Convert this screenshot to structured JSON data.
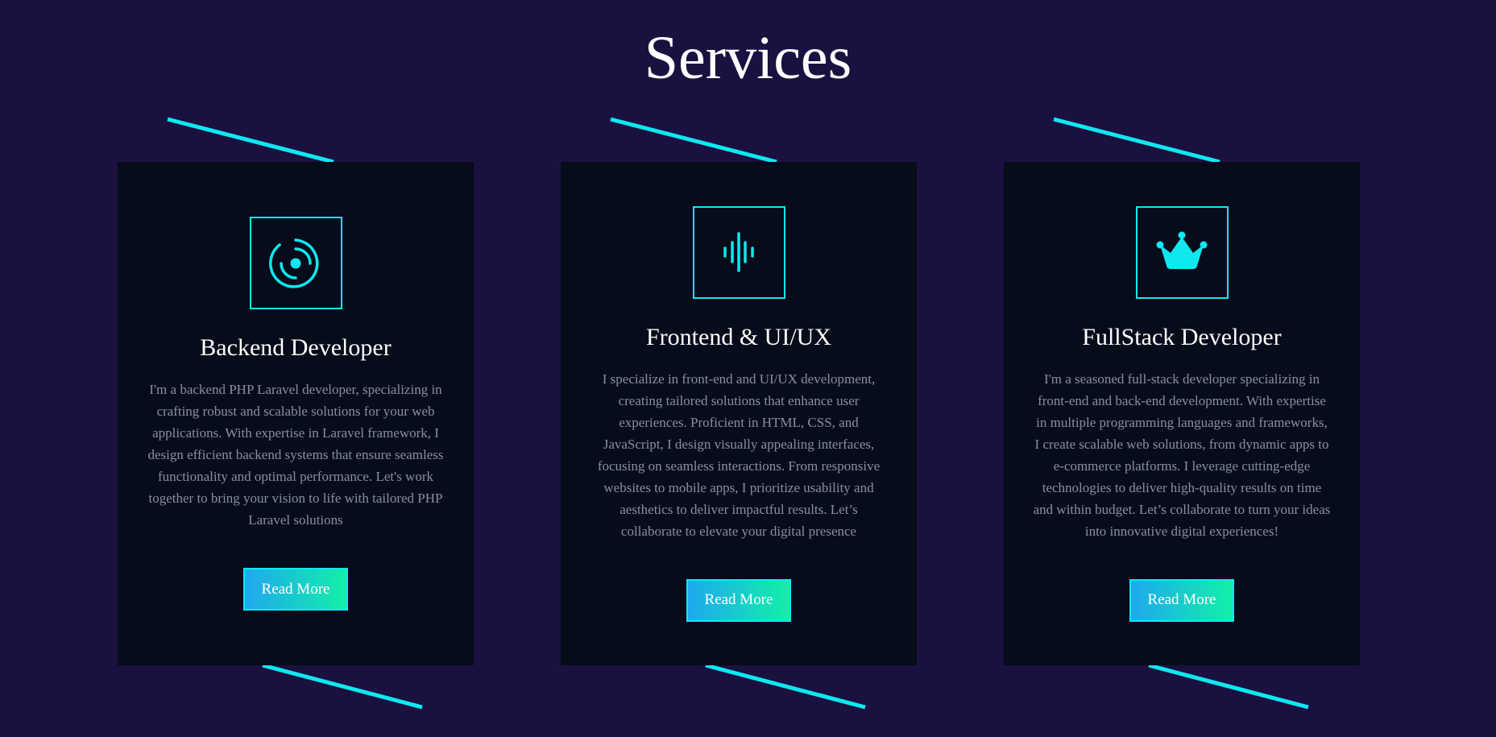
{
  "page": {
    "title": "Services",
    "background_color": "#1a1140",
    "card_color": "#060c1a",
    "accent_color": "#0fe8f0"
  },
  "cards": [
    {
      "icon": "target-icon",
      "title": "Backend Developer",
      "description": "I'm a backend PHP Laravel developer, specializing in crafting robust and scalable solutions for your web applications. With expertise in Laravel framework, I design efficient backend systems that ensure seamless functionality and optimal performance. Let's work together to bring your vision to life with tailored PHP Laravel solutions",
      "button_label": "Read More"
    },
    {
      "icon": "sound-wave-icon",
      "title": "Frontend & UI/UX",
      "description": "I specialize in front-end and UI/UX development, creating tailored solutions that enhance user experiences. Proficient in HTML, CSS, and JavaScript, I design visually appealing interfaces, focusing on seamless interactions. From responsive websites to mobile apps, I prioritize usability and aesthetics to deliver impactful results. Let’s collaborate to elevate your digital presence",
      "button_label": "Read More"
    },
    {
      "icon": "crown-icon",
      "title": "FullStack Developer",
      "description": "I'm a seasoned full-stack developer specializing in front-end and back-end development. With expertise in multiple programming languages and frameworks, I create scalable web solutions, from dynamic apps to e-commerce platforms. I leverage cutting-edge technologies to deliver high-quality results on time and within budget. Let’s collaborate to turn your ideas into innovative digital experiences!",
      "button_label": "Read More"
    }
  ]
}
